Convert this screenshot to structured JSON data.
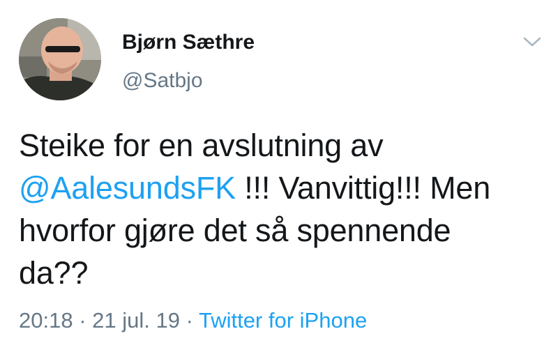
{
  "user": {
    "display_name": "Bjørn Sæthre",
    "handle": "@Satbjo",
    "avatar_icon": "profile-photo"
  },
  "tweet": {
    "line1": "Steike for en avslutning av",
    "mention": "@AalesundsFK",
    "after_mention": " !!! Vanvittig!!! Men",
    "line3": "hvorfor gjøre det så spennende",
    "line4": "da??"
  },
  "meta": {
    "time": "20:18",
    "sep1": " · ",
    "date": "21 jul. 19",
    "sep2": " · ",
    "source": "Twitter for iPhone"
  },
  "menu": {
    "icon": "chevron-down-icon"
  },
  "colors": {
    "link": "#1da1f2",
    "text": "#14171a",
    "muted": "#657786",
    "chevron": "#aab8c2"
  }
}
